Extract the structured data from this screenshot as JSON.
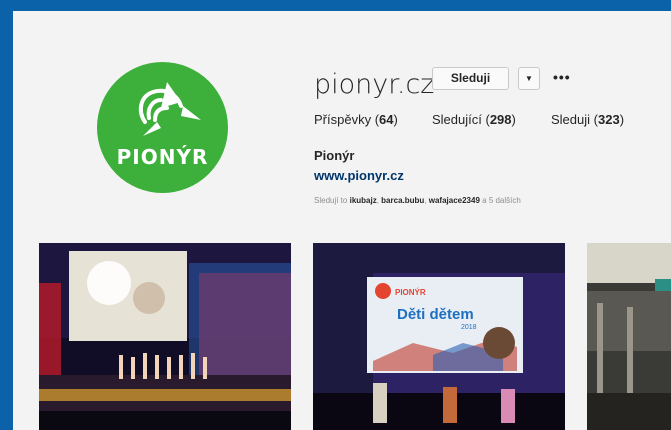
{
  "profile": {
    "username": "pionyr.cz",
    "follow_label": "Sleduji",
    "more_label": "•••",
    "caret_icon": "chevron-down-icon",
    "logo_text": "PIONÝR",
    "logo_color": "#3cb03a",
    "full_name": "Pionýr",
    "website": "www.pionyr.cz"
  },
  "stats": {
    "posts_label": "Příspěvky",
    "posts_count": "64",
    "followers_label": "Sledující",
    "followers_count": "298",
    "following_label": "Sleduji",
    "following_count": "323"
  },
  "followed_by": {
    "prefix": "Sledují to",
    "users": [
      "ikubajz",
      "barca.bubu",
      "wafajace2349"
    ],
    "suffix": "a 5 dalších"
  },
  "posts": {
    "slide_brand": "PIONÝR",
    "slide_title": "Děti dětem",
    "slide_year": "2018"
  },
  "colors": {
    "frame_border": "#0b62a8",
    "background": "#f3f3f3",
    "link": "#003569"
  }
}
